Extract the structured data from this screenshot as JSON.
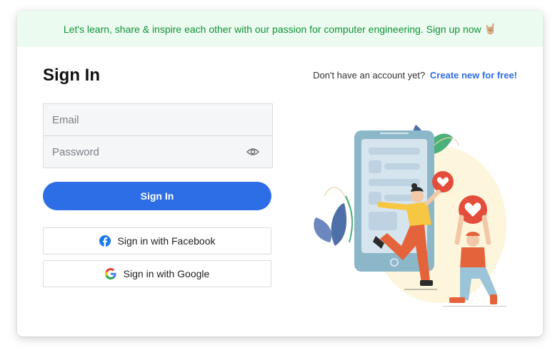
{
  "banner": {
    "text": "Let's learn, share & inspire each other with our passion for computer engineering. Sign up now",
    "emoji": "🤘🏼"
  },
  "signin": {
    "title": "Sign In",
    "no_account_text": "Don't have an account yet?",
    "create_link": "Create new for free!",
    "email_placeholder": "Email",
    "password_placeholder": "Password",
    "submit_label": "Sign In",
    "facebook_label": "Sign in with Facebook",
    "google_label": "Sign in with Google"
  },
  "colors": {
    "primary": "#2d6ee6",
    "banner_bg": "#ecfbef",
    "banner_text": "#12923a",
    "link": "#2f6de1"
  },
  "icons": [
    "eye-icon",
    "facebook-icon",
    "google-icon"
  ]
}
